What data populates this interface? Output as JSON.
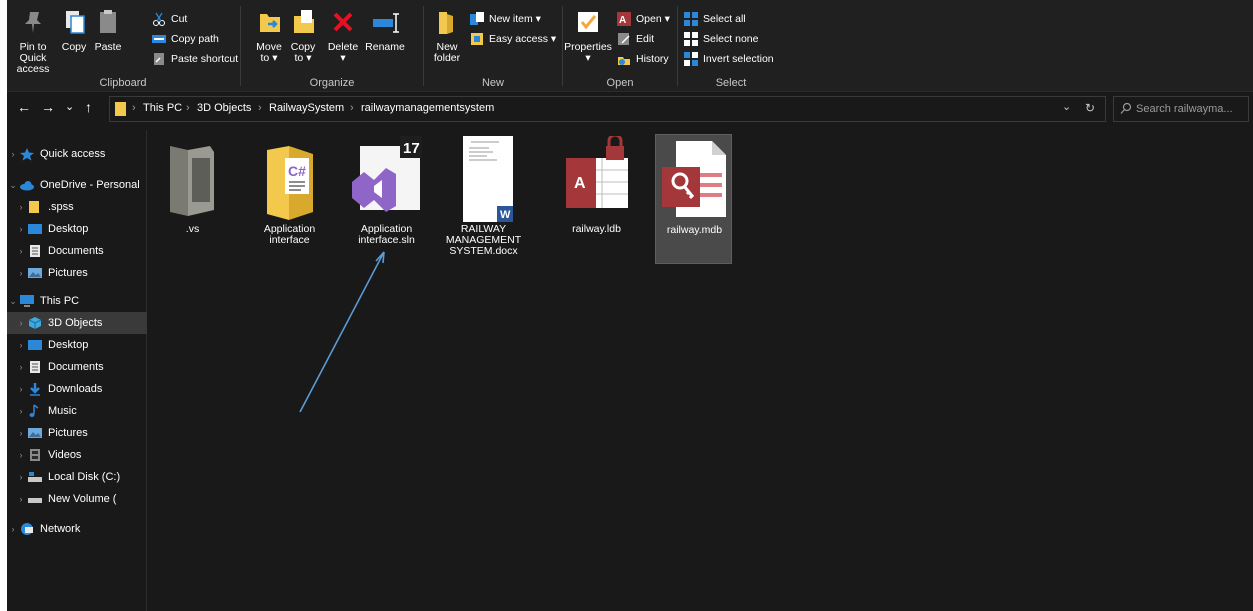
{
  "ribbon": {
    "clipboard": {
      "group_label": "Clipboard",
      "pin_label": "Pin to Quick access",
      "copy_label": "Copy",
      "paste_label": "Paste",
      "cut_label": "Cut",
      "copy_path_label": "Copy path",
      "paste_shortcut_label": "Paste shortcut"
    },
    "organize": {
      "group_label": "Organize",
      "move_to_label": "Move to ▾",
      "copy_to_label": "Copy to ▾",
      "delete_label": "Delete ▾",
      "rename_label": "Rename"
    },
    "new": {
      "group_label": "New",
      "new_folder_label": "New folder",
      "new_item_label": "New item ▾",
      "easy_access_label": "Easy access ▾"
    },
    "open": {
      "group_label": "Open",
      "properties_label": "Properties ▾",
      "open_label": "Open ▾",
      "edit_label": "Edit",
      "history_label": "History"
    },
    "select": {
      "group_label": "Select",
      "select_all_label": "Select all",
      "select_none_label": "Select none",
      "invert_label": "Invert selection"
    }
  },
  "address": {
    "back": "←",
    "forward": "→",
    "recent": "⌄",
    "up": "↑",
    "crumbs": [
      "This PC",
      "3D Objects",
      "RailwaySystem",
      "railwaymanagementsystem"
    ],
    "separator": "›",
    "dropdown": "⌄",
    "refresh": "↻"
  },
  "search": {
    "placeholder": "Search railwayma..."
  },
  "nav": {
    "items": [
      {
        "label": "Quick access",
        "icon": "star-icon"
      },
      {
        "label": "OneDrive - Personal",
        "icon": "cloud-icon"
      },
      {
        "label": ".spss",
        "icon": "folder-icon"
      },
      {
        "label": "Desktop",
        "icon": "desktop-icon"
      },
      {
        "label": "Documents",
        "icon": "documents-icon"
      },
      {
        "label": "Pictures",
        "icon": "pictures-icon"
      },
      {
        "label": "This PC",
        "icon": "computer-icon"
      },
      {
        "label": "3D Objects",
        "icon": "cube-icon"
      },
      {
        "label": "Desktop",
        "icon": "desktop-icon"
      },
      {
        "label": "Documents",
        "icon": "documents-icon"
      },
      {
        "label": "Downloads",
        "icon": "download-icon"
      },
      {
        "label": "Music",
        "icon": "music-icon"
      },
      {
        "label": "Pictures",
        "icon": "pictures-icon"
      },
      {
        "label": "Videos",
        "icon": "video-icon"
      },
      {
        "label": "Local Disk (C:)",
        "icon": "drive-icon"
      },
      {
        "label": "New Volume (",
        "icon": "drive-icon"
      },
      {
        "label": "Network",
        "icon": "network-icon"
      }
    ]
  },
  "files": [
    {
      "name": ".vs",
      "type": "folder"
    },
    {
      "name": "Application interface",
      "type": "folder-csharp"
    },
    {
      "name": "Application interface.sln",
      "type": "visual-studio-solution",
      "badge": "17"
    },
    {
      "name": "RAILWAY MANAGEMENT SYSTEM.docx",
      "type": "word-document"
    },
    {
      "name": "railway.ldb",
      "type": "access-lock"
    },
    {
      "name": "railway.mdb",
      "type": "access-database",
      "selected": true
    }
  ],
  "colors": {
    "background": "#191919",
    "ribbon": "#202020",
    "accent_blue": "#2b87d8",
    "folder_yellow": "#f2c94c",
    "access_red": "#a4373a",
    "vs_purple": "#8f65c8",
    "annotation_arrow": "#5b9bd5"
  }
}
